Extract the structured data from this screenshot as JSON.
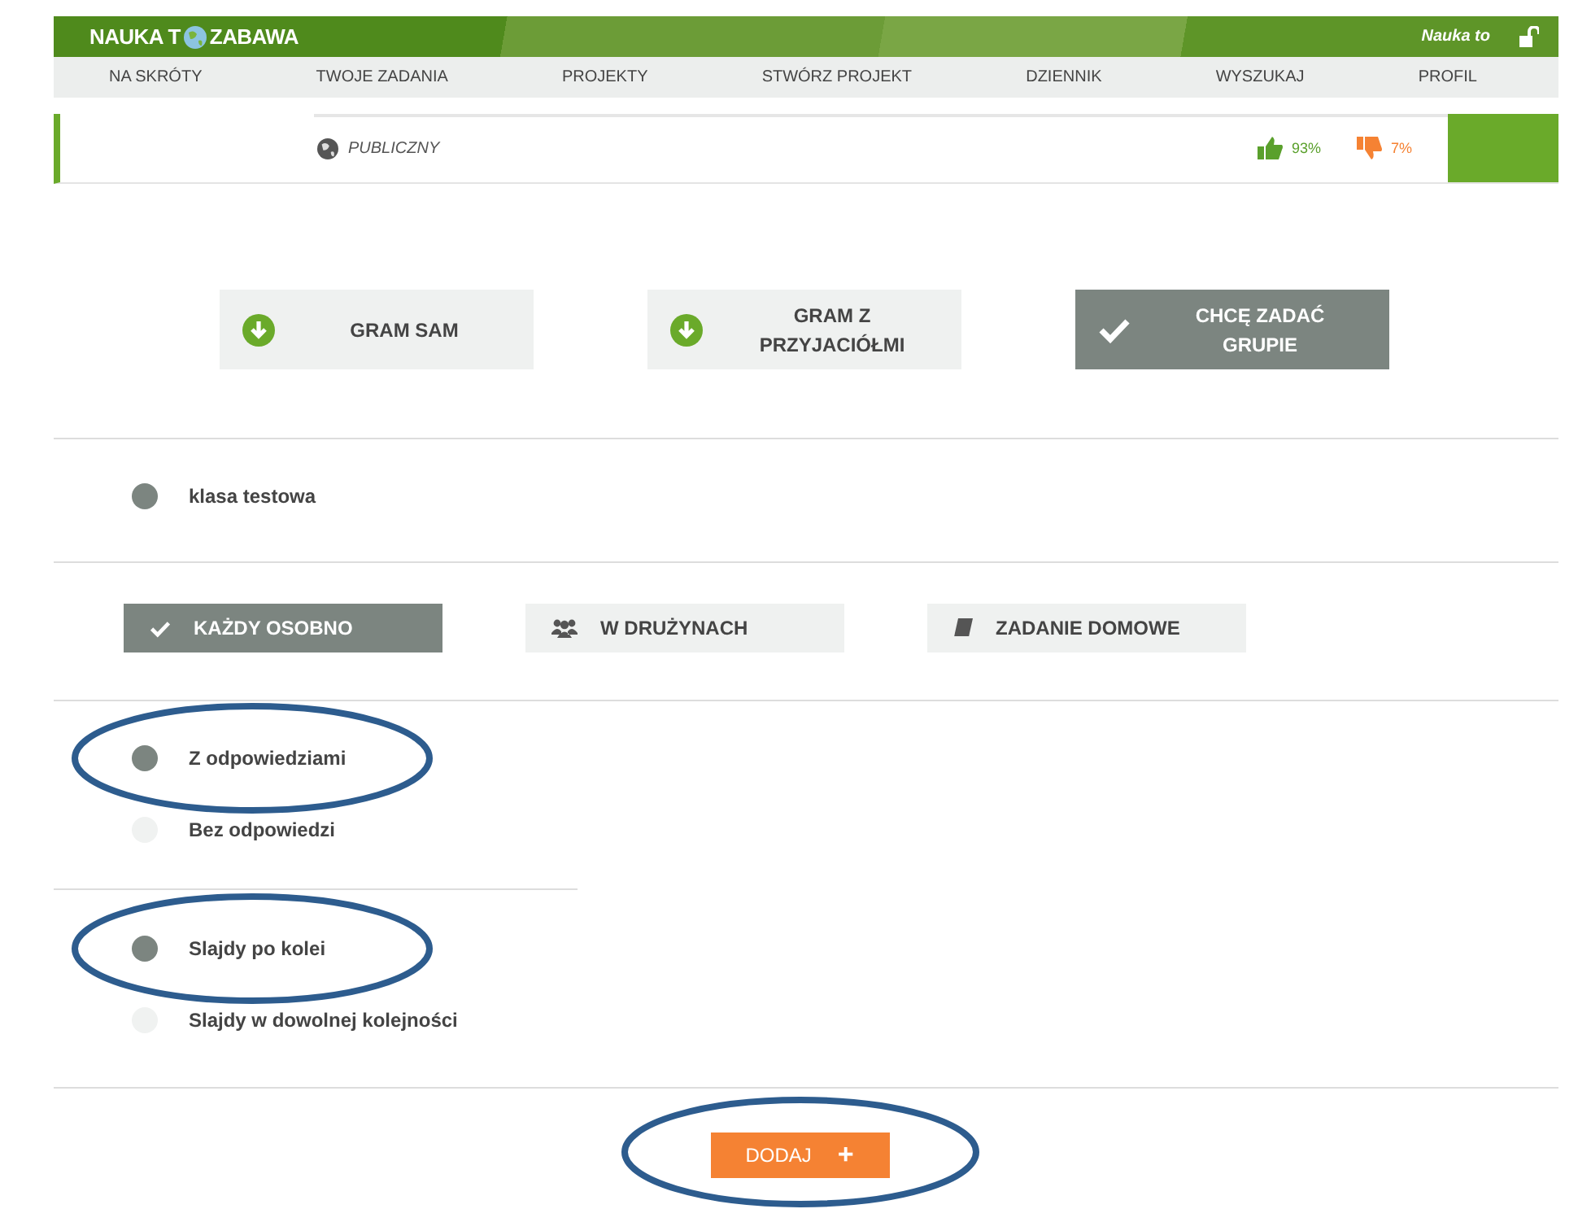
{
  "header": {
    "logo_left": "NAUKA T",
    "logo_right": "ZABAWA",
    "user": "Nauka to"
  },
  "nav": [
    {
      "label": "NA SKRÓTY"
    },
    {
      "label": "TWOJE ZADANIA"
    },
    {
      "label": "PROJEKTY"
    },
    {
      "label": "STWÓRZ PROJEKT"
    },
    {
      "label": "DZIENNIK"
    },
    {
      "label": "WYSZUKAJ"
    },
    {
      "label": "PROFIL"
    }
  ],
  "info": {
    "visibility": "PUBLICZNY",
    "likes": "93%",
    "dislikes": "7%"
  },
  "modes": [
    {
      "label": "GRAM SAM",
      "selected": false
    },
    {
      "label": "GRAM Z PRZYJACIÓŁMI",
      "selected": false
    },
    {
      "label": "CHCĘ ZADAĆ GRUPIE",
      "selected": true
    }
  ],
  "classes": [
    {
      "label": "klasa testowa",
      "selected": true
    }
  ],
  "group_modes": [
    {
      "label": "KAŻDY OSOBNO",
      "kind": "check",
      "selected": true
    },
    {
      "label": "W DRUŻYNACH",
      "kind": "people",
      "selected": false
    },
    {
      "label": "ZADANIE DOMOWE",
      "kind": "book",
      "selected": false
    }
  ],
  "answer_options": [
    {
      "label": "Z odpowiedziami",
      "selected": true,
      "circled": true
    },
    {
      "label": "Bez odpowiedzi",
      "selected": false,
      "circled": false
    }
  ],
  "order_options": [
    {
      "label": "Slajdy po kolei",
      "selected": true,
      "circled": true
    },
    {
      "label": "Slajdy w dowolnej kolejności",
      "selected": false,
      "circled": false
    }
  ],
  "add_button": {
    "label": "DODAJ",
    "symbol": "+",
    "circled": true
  }
}
